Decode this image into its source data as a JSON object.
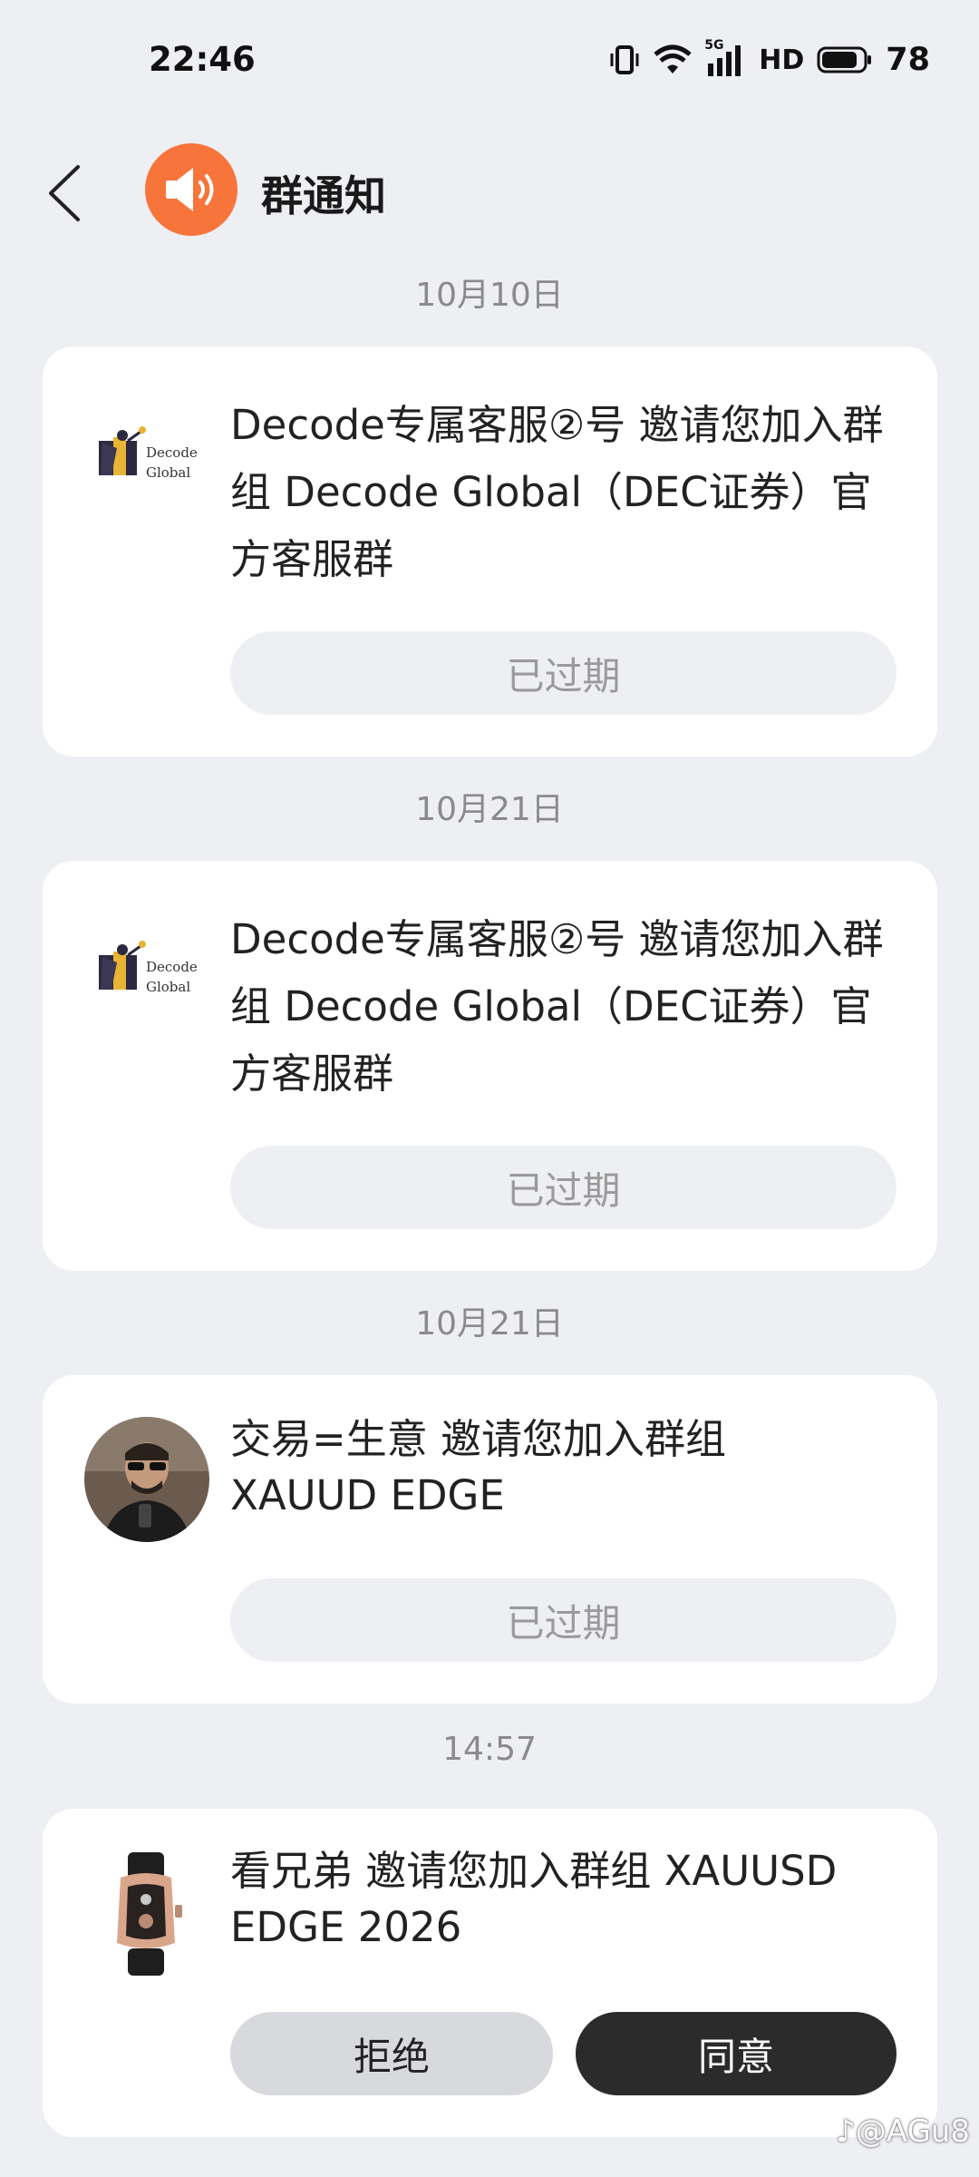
{
  "status_bar": {
    "time": "22:46",
    "network_label": "HD",
    "signal_label": "5G",
    "battery_percent": "78"
  },
  "header": {
    "title": "群通知",
    "avatar_icon": "speaker-icon",
    "avatar_color": "#f7743a"
  },
  "notifications": [
    {
      "date": "10月10日",
      "avatar_logo_lines": [
        "Decode",
        "Global"
      ],
      "text": "Decode专属客服②号 邀请您加入群组 Decode Global（DEC证券）官方客服群",
      "status": "已过期"
    },
    {
      "date": "10月21日",
      "avatar_logo_lines": [
        "Decode",
        "Global"
      ],
      "text": "Decode专属客服②号 邀请您加入群组 Decode Global（DEC证券）官方客服群",
      "status": "已过期"
    },
    {
      "date": "10月21日",
      "text_line1": "交易=生意 邀请您加入群组",
      "text_line2": "XAUUD EDGE",
      "status": "已过期"
    },
    {
      "date": "14:57",
      "text_line1": "看兄弟 邀请您加入群组 XAUUSD",
      "text_line2": "EDGE 2026",
      "reject_label": "拒绝",
      "accept_label": "同意"
    }
  ],
  "watermark": "@AGu8",
  "colors": {
    "background": "#eeeff3",
    "card": "#ffffff",
    "accept_button": "#2b2b2b",
    "reject_button": "#d8d9dd"
  }
}
